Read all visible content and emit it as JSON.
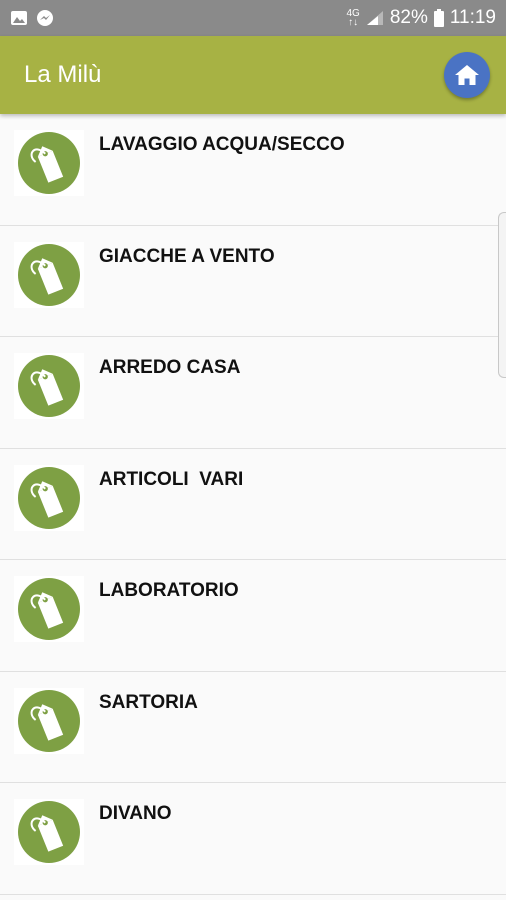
{
  "status_bar": {
    "network_top": "4G",
    "network_bottom": "↑↓",
    "battery": "82%",
    "time": "11:19"
  },
  "app_bar": {
    "title": "La Milù"
  },
  "list": {
    "items": [
      {
        "label": "LAVAGGIO ACQUA/SECCO"
      },
      {
        "label": "GIACCHE A VENTO"
      },
      {
        "label": "ARREDO CASA"
      },
      {
        "label": "ARTICOLI  VARI"
      },
      {
        "label": "LABORATORIO"
      },
      {
        "label": "SARTORIA"
      },
      {
        "label": "DIVANO"
      }
    ]
  },
  "colors": {
    "app_bar": "#a7b244",
    "status_bar": "#8a8a8a",
    "icon_circle": "#7ea044",
    "home_button": "#4a73c4"
  },
  "icons": {
    "item": "price-tag-icon",
    "home": "home-icon"
  }
}
